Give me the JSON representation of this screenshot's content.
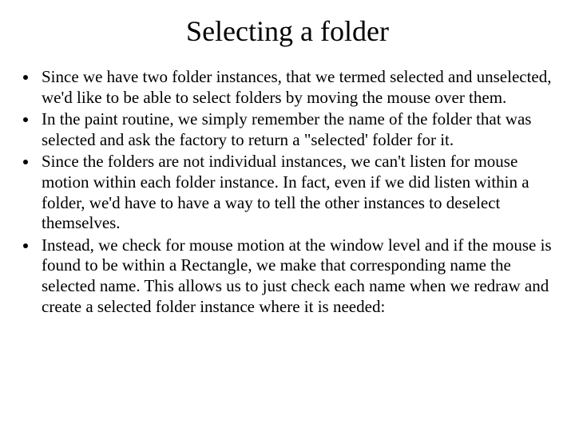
{
  "title": "Selecting a folder",
  "bullets": [
    "Since we have two folder instances, that we termed selected and unselected, we'd like to be able to select folders by moving the mouse over them.",
    "In the paint routine, we simply remember the name of the folder that was selected and ask the factory to return a \"selected' folder for it.",
    "Since the folders are not individual instances, we can't listen for mouse motion within each folder instance. In fact, even if we did listen within a folder, we'd have to have a way to tell the other instances to deselect themselves.",
    "Instead, we check for mouse motion at the window level and if the mouse is found to be within a Rectangle, we make that corresponding name the selected name. This allows us to just check each name when we redraw and create a selected folder instance where it is needed:"
  ]
}
